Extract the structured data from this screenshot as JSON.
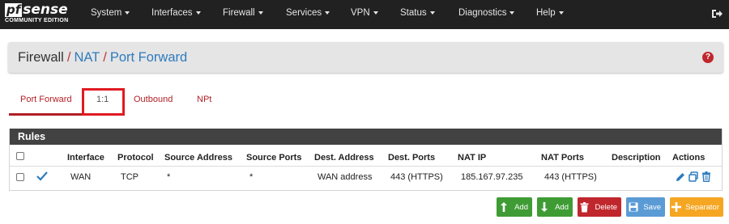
{
  "brand": {
    "logo_pf": "pf",
    "logo_sense": "sense",
    "logo_sub": "COMMUNITY EDITION"
  },
  "nav": {
    "items": [
      {
        "label": "System"
      },
      {
        "label": "Interfaces"
      },
      {
        "label": "Firewall"
      },
      {
        "label": "Services"
      },
      {
        "label": "VPN"
      },
      {
        "label": "Status"
      },
      {
        "label": "Diagnostics"
      },
      {
        "label": "Help"
      }
    ],
    "logout_icon": "logout-icon"
  },
  "breadcrumb": {
    "root": "Firewall",
    "sep": "/",
    "level2": "NAT",
    "level3": "Port Forward",
    "help_icon": "question-circle-icon"
  },
  "tabs": [
    {
      "label": "Port Forward",
      "active": true
    },
    {
      "label": "1:1"
    },
    {
      "label": "Outbound"
    },
    {
      "label": "NPt"
    }
  ],
  "rules": {
    "title": "Rules",
    "columns": [
      "Interface",
      "Protocol",
      "Source Address",
      "Source Ports",
      "Dest. Address",
      "Dest. Ports",
      "NAT IP",
      "NAT Ports",
      "Description",
      "Actions"
    ],
    "rows": [
      {
        "enabled": true,
        "interface": "WAN",
        "protocol": "TCP",
        "source_address": "*",
        "source_ports": "*",
        "dest_address": "WAN address",
        "dest_ports": "443 (HTTPS)",
        "nat_ip": "185.167.97.235",
        "nat_ports": "443 (HTTPS)",
        "description": ""
      }
    ]
  },
  "buttons": {
    "add_top": "Add",
    "add_bottom": "Add",
    "delete": "Delete",
    "save": "Save",
    "separator": "Separator"
  },
  "colors": {
    "nav_bg": "#212121",
    "accent_red": "#b21f24",
    "link_blue": "#2e7bbd",
    "success": "#3f9c35",
    "danger": "#c0272d",
    "info": "#5b9bd5",
    "warning": "#f5a623"
  }
}
